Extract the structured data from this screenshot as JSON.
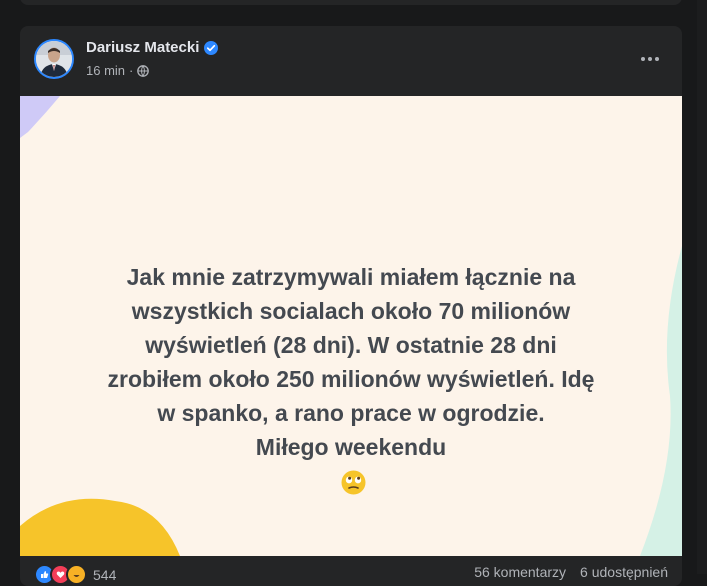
{
  "post": {
    "author": "Dariusz Matecki",
    "time": "16 min",
    "separator": "·",
    "text": "Jak mnie zatrzymywali miałem łącznie na\nwszystkich socialach około 70 milionów\nwyświetleń (28 dni). W ostatnie 28 dni\nzrobiłem około 250 milionów wyświetleń. Idę\nw spanko, a rano prace w ogrodzie.\nMiłego weekendu",
    "emoji": "eye-roll-face",
    "background_color": "#fdf4ea",
    "accent_colors": [
      "#f5c518",
      "#c9c3f5",
      "#d3f0e4"
    ]
  },
  "footer": {
    "reaction_count": "544",
    "comments": "56 komentarzy",
    "shares": "6 udostępnień"
  }
}
